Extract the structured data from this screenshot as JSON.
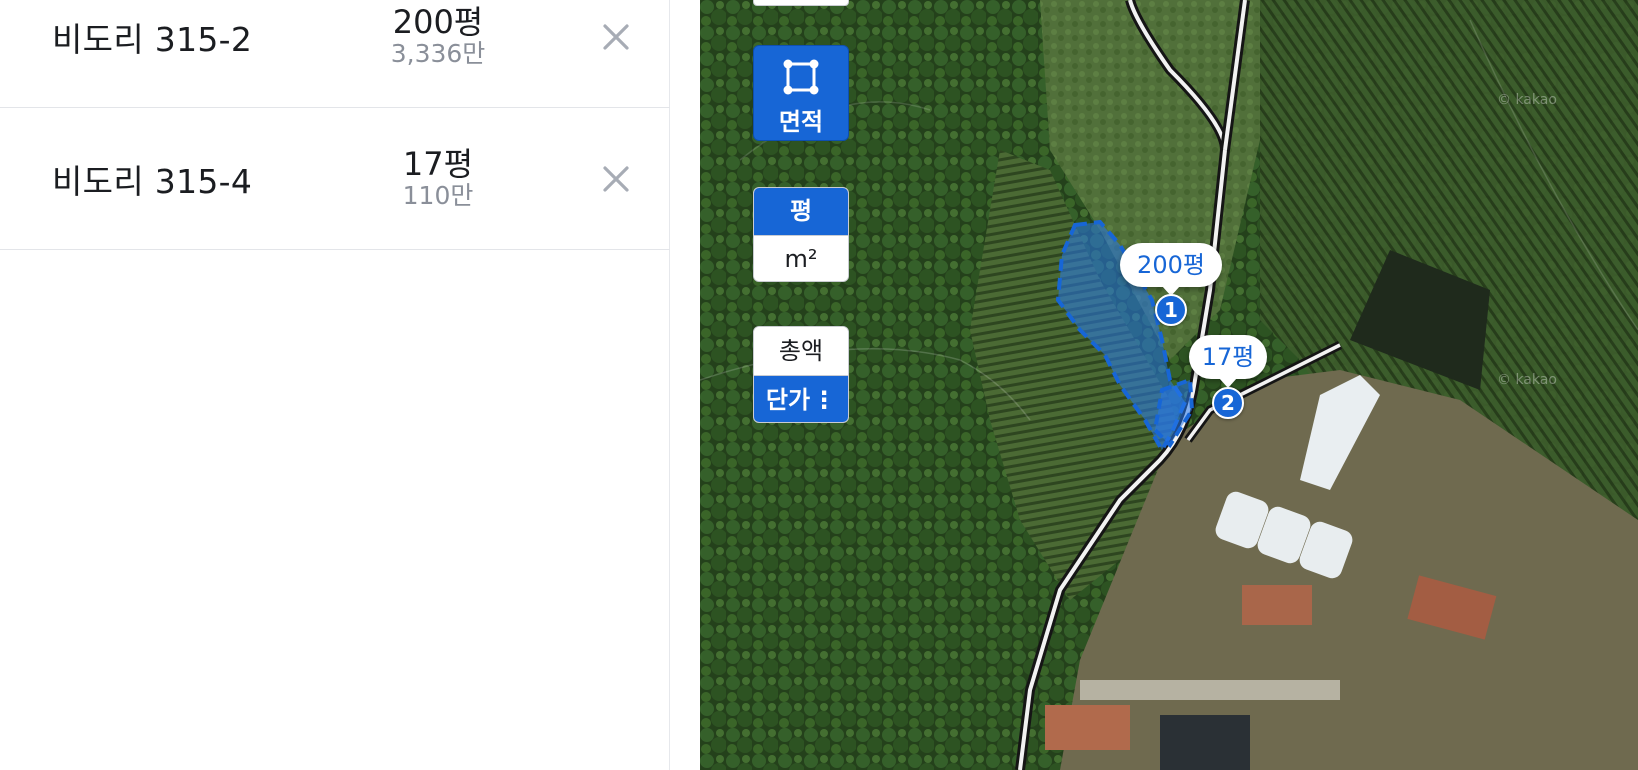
{
  "parcels": [
    {
      "address": "비도리 315-2",
      "area": "200평",
      "price": "3,336만",
      "marker": "1"
    },
    {
      "address": "비도리 315-4",
      "area": "17평",
      "price": "110만",
      "marker": "2"
    }
  ],
  "controls": {
    "area_button": {
      "label": "면적",
      "icon": "polygon-select-icon"
    },
    "unit_toggle": {
      "options": [
        "평",
        "m²"
      ],
      "selected": "평"
    },
    "price_toggle": {
      "options": [
        "총액",
        "단가"
      ],
      "selected": "단가",
      "menu_icon": "kebab-icon"
    }
  },
  "map": {
    "attribution": "© kakao",
    "selection_color": "#1766d6"
  }
}
